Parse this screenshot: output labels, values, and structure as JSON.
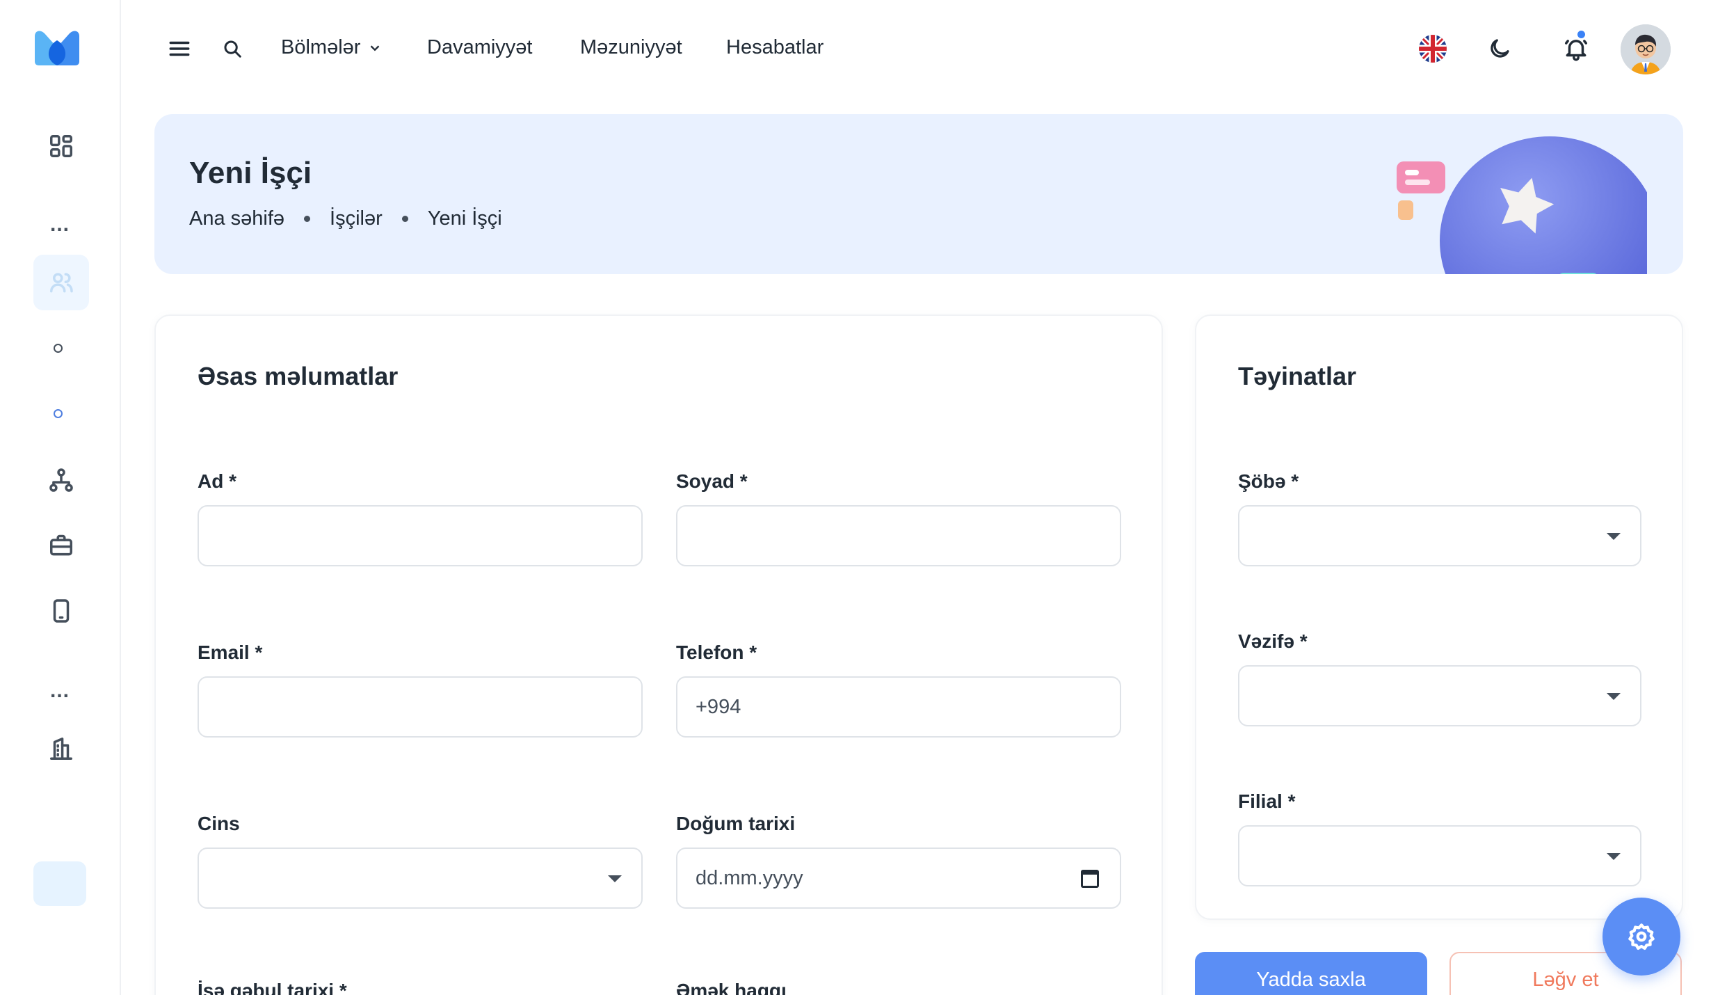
{
  "topbar": {
    "nav": [
      {
        "label": "Bölmələr",
        "has_dropdown": true
      },
      {
        "label": "Davamiyyət"
      },
      {
        "label": "Məzuniyyət"
      },
      {
        "label": "Hesabatlar"
      }
    ],
    "icons": [
      "menu-icon",
      "search-icon",
      "uk-flag-icon",
      "moon-icon",
      "bell-icon"
    ],
    "notification_dot": true
  },
  "banner": {
    "title": "Yeni İşçi",
    "breadcrumbs": [
      "Ana səhifə",
      "İşçilər",
      "Yeni İşçi"
    ]
  },
  "main_card": {
    "title": "Əsas məlumatlar",
    "fields": {
      "first_name": {
        "label": "Ad *",
        "value": ""
      },
      "last_name": {
        "label": "Soyad *",
        "value": ""
      },
      "email": {
        "label": "Email *",
        "value": ""
      },
      "phone": {
        "label": "Telefon *",
        "value": "+994"
      },
      "gender": {
        "label": "Cins",
        "value": ""
      },
      "birth_date": {
        "label": "Doğum tarixi",
        "placeholder": "dd.mm.yyyy"
      },
      "hire_date": {
        "label": "İşə qəbul tarixi *"
      },
      "salary": {
        "label": "Əmək haqqı"
      }
    }
  },
  "assign_card": {
    "title": "Təyinatlar",
    "fields": {
      "department": {
        "label": "Şöbə *",
        "value": ""
      },
      "position": {
        "label": "Vəzifə *",
        "value": ""
      },
      "branch": {
        "label": "Filial *",
        "value": ""
      }
    }
  },
  "actions": {
    "save": "Yadda saxla",
    "cancel": "Ləğv et"
  },
  "colors": {
    "accent": "#5b8ef5",
    "banner_bg": "#e9f1ff",
    "cancel": "#f0795c",
    "active_nav_bg": "#eef6ff"
  }
}
